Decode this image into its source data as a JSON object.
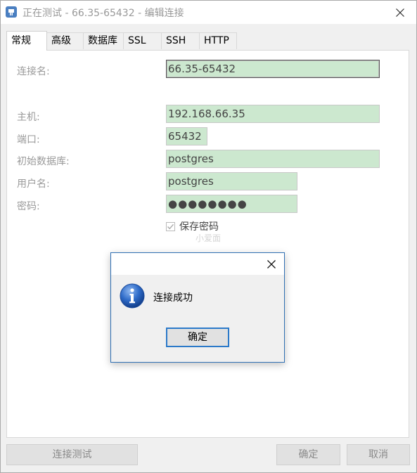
{
  "window": {
    "title": "正在测试 - 66.35-65432 - 编辑连接",
    "icon": "postgres-elephant-icon"
  },
  "tabs": [
    {
      "label": "常规",
      "active": true
    },
    {
      "label": "高级",
      "active": false
    },
    {
      "label": "数据库",
      "active": false
    },
    {
      "label": "SSL",
      "active": false
    },
    {
      "label": "SSH",
      "active": false
    },
    {
      "label": "HTTP",
      "active": false
    }
  ],
  "form": {
    "connection_name": {
      "label": "连接名:",
      "value": "66.35-65432"
    },
    "host": {
      "label": "主机:",
      "value": "192.168.66.35"
    },
    "port": {
      "label": "端口:",
      "value": "65432"
    },
    "initial_database": {
      "label": "初始数据库:",
      "value": "postgres"
    },
    "username": {
      "label": "用户名:",
      "value": "postgres"
    },
    "password": {
      "label": "密码:",
      "value": "●●●●●●●●"
    },
    "save_password": {
      "label": "保存密码",
      "checked": true
    }
  },
  "watermark": "小爱面",
  "buttons": {
    "test_connection": "连接测试",
    "ok": "确定",
    "cancel": "取消"
  },
  "dialog": {
    "message": "连接成功",
    "ok_label": "确定",
    "icon": "info-icon"
  },
  "colors": {
    "field_bg": "#cce8cf",
    "dialog_border": "#2f6fb3",
    "info_blue": "#1f5fbf"
  }
}
